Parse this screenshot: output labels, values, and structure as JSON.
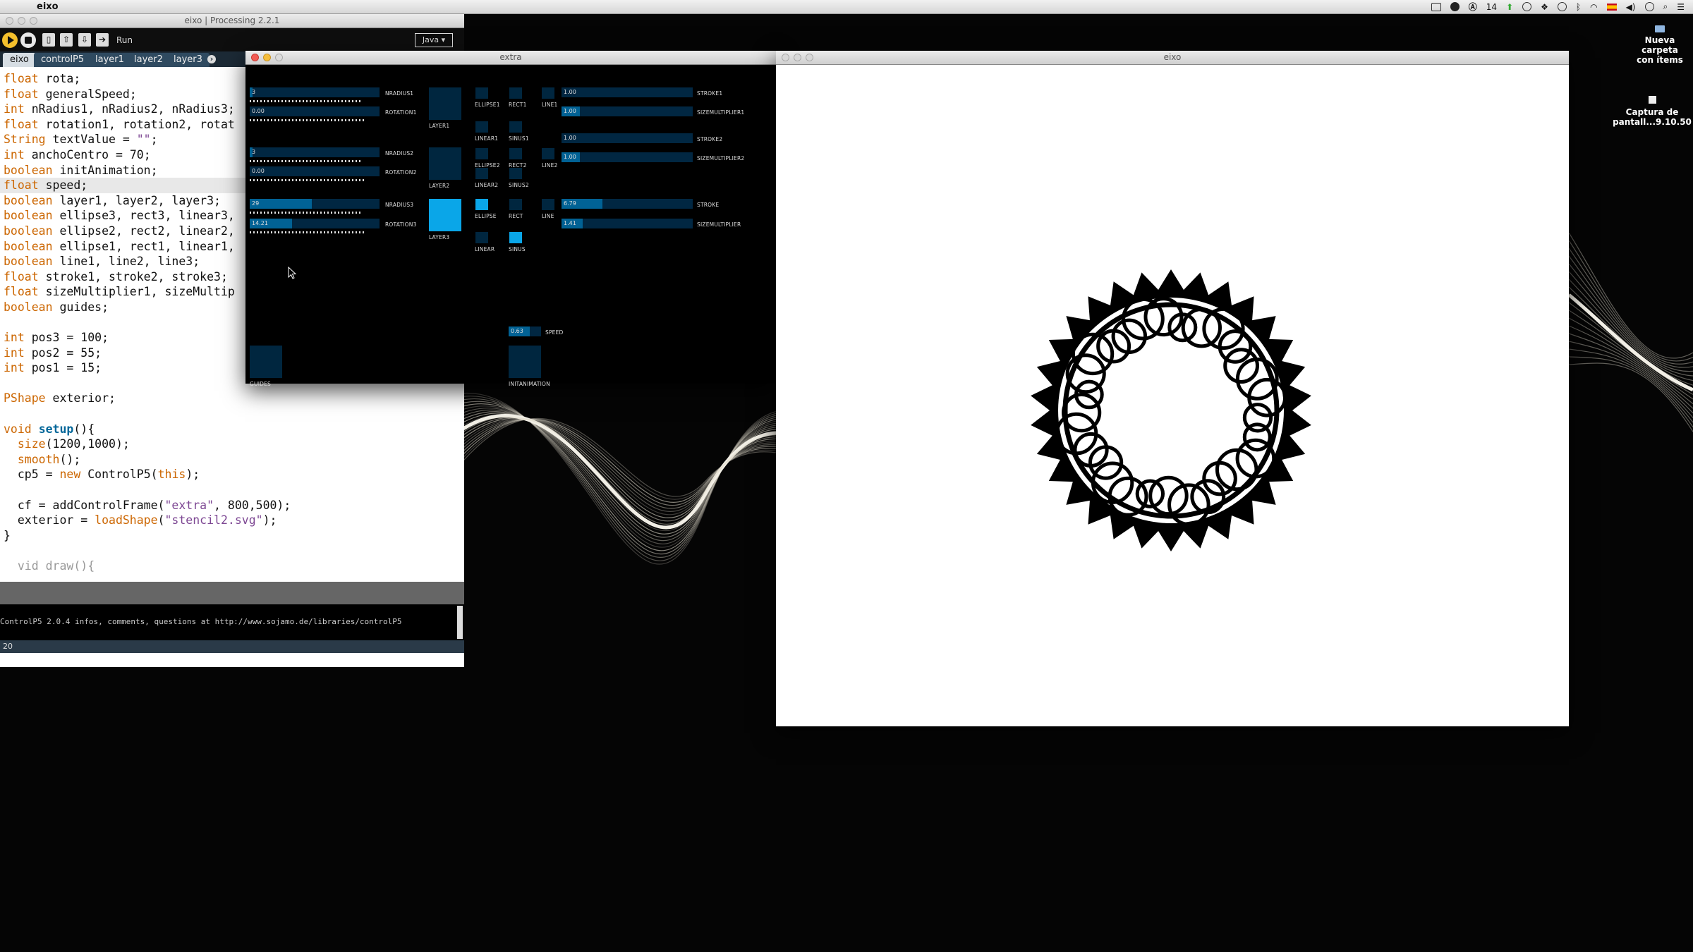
{
  "menubar": {
    "app_name": "eixo",
    "status_number": "14"
  },
  "desktop": {
    "folder_label_1": "Nueva carpeta",
    "folder_label_2": "con ítems",
    "capture_label_1": "Captura de",
    "capture_label_2": "pantall...9.10.50"
  },
  "editor": {
    "title": "eixo | Processing 2.2.1",
    "run_label": "Run",
    "mode_label": "Java ▾",
    "tabs": [
      "eixo",
      "controlP5",
      "layer1",
      "layer2",
      "layer3"
    ],
    "console_message": "ControlP5 2.0.4 infos, comments, questions at http://www.sojamo.de/libraries/controlP5",
    "line_number": "20"
  },
  "extra": {
    "title": "extra",
    "sliders": {
      "nradius1": {
        "label": "NRADIUS1",
        "value": "3"
      },
      "rotation1": {
        "label": "ROTATION1",
        "value": "0.00"
      },
      "nradius2": {
        "label": "NRADIUS2",
        "value": "3"
      },
      "rotation2": {
        "label": "ROTATION2",
        "value": "0.00"
      },
      "nradius3": {
        "label": "NRADIUS3",
        "value": "29"
      },
      "rotation3": {
        "label": "ROTATION3",
        "value": "14.21"
      },
      "stroke1": {
        "label": "STROKE1",
        "value": "1.00"
      },
      "sizemult1": {
        "label": "SIZEMULTIPLIER1",
        "value": "1.00"
      },
      "stroke2": {
        "label": "STROKE2",
        "value": "1.00"
      },
      "sizemult2": {
        "label": "SIZEMULTIPLIER2",
        "value": "1.00"
      },
      "stroke3": {
        "label": "STROKE",
        "value": "6.79"
      },
      "sizemult3": {
        "label": "SIZEMULTIPLIER",
        "value": "1.41"
      },
      "speed": {
        "label": "SPEED",
        "value": "0.63"
      }
    },
    "toggles": {
      "layer1": "LAYER1",
      "layer2": "LAYER2",
      "layer3": "LAYER3",
      "ellipse1": "ELLIPSE1",
      "rect1": "RECT1",
      "line1": "LINE1",
      "linear1": "LINEAR1",
      "sinus1": "SINUS1",
      "ellipse2": "ELLIPSE2",
      "rect2": "RECT2",
      "line2": "LINE2",
      "linear2": "LINEAR2",
      "sinus2": "SINUS2",
      "ellipse3": "ELLIPSE",
      "rect3": "RECT",
      "line3": "LINE",
      "linear3": "LINEAR",
      "sinus3": "SINUS",
      "guides": "GUIDES",
      "initanimation": "INITANIMATION"
    }
  },
  "eixo": {
    "title": "eixo"
  },
  "colors": {
    "cp5_bg": "#012742",
    "cp5_fg": "#016295",
    "cp5_active": "#0aa6e8",
    "keyword": "#cc6600",
    "function": "#006699"
  }
}
